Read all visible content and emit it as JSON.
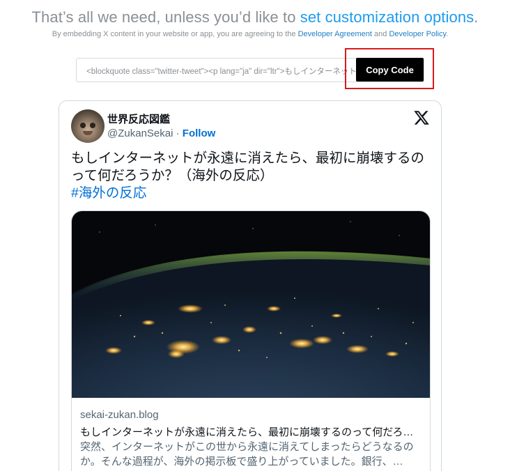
{
  "header": {
    "headline_prefix": "That’s all we need, unless you’d like to ",
    "headline_link": "set customization options",
    "headline_suffix": ".",
    "subline_prefix": "By embedding X content in your website or app, you are agreeing to the ",
    "developer_agreement": "Developer Agreement",
    "subline_and": " and ",
    "developer_policy": "Developer Policy",
    "subline_suffix": "."
  },
  "embed": {
    "code_preview": "<blockquote class=\"twitter-tweet\"><p lang=\"ja\" dir=\"ltr\">もしインターネットが永遠に消えたら",
    "copy_label": "Copy Code"
  },
  "tweet": {
    "display_name": "世界反応図鑑",
    "handle": "@ZukanSekai",
    "separator": " · ",
    "follow_label": "Follow",
    "text": "もしインターネットが永遠に消えたら、最初に崩壊するのって何だろうか？（海外の反応）",
    "hashtag": "#海外の反応",
    "card": {
      "domain": "sekai-zukan.blog",
      "title": "もしインターネットが永遠に消えたら、最初に崩壊するのって何だろうか？（海外の反応）",
      "description": "突然、インターネットがこの世から永遠に消えてしまったらどうなるのか。そんな過程が、海外の掲示板で盛り上がっていました。銀行、…"
    }
  },
  "colors": {
    "accent": "#1d9bf0",
    "link": "#006fd6",
    "button": "#000000",
    "highlight": "#d61a1a"
  },
  "icons": {
    "x_logo": "x-logo-icon",
    "avatar": "avatar"
  }
}
